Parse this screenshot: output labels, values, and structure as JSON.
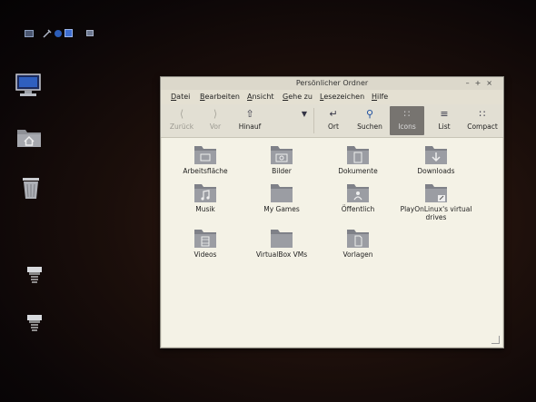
{
  "taskbar": {
    "item_label": ""
  },
  "window": {
    "title": "Persönlicher Ordner",
    "controls": {
      "minimize": "–",
      "maximize": "+",
      "close": "×"
    }
  },
  "menu": [
    {
      "label": "Datei",
      "ul": "D",
      "rest": "atei"
    },
    {
      "label": "Bearbeiten",
      "ul": "B",
      "rest": "earbeiten"
    },
    {
      "label": "Ansicht",
      "ul": "A",
      "rest": "nsicht"
    },
    {
      "label": "Gehe zu",
      "ul": "G",
      "rest": "ehe zu"
    },
    {
      "label": "Lesezeichen",
      "ul": "L",
      "rest": "esezeichen"
    },
    {
      "label": "Hilfe",
      "ul": "H",
      "rest": "ilfe"
    }
  ],
  "toolbar": {
    "back": {
      "label": "Zurück",
      "icon": "arrow-left-icon",
      "enabled": false
    },
    "forward": {
      "label": "Vor",
      "icon": "arrow-right-icon",
      "enabled": false
    },
    "up": {
      "label": "Hinauf",
      "icon": "arrow-up-icon"
    },
    "location": {
      "label": "Ort",
      "icon": "location-icon"
    },
    "search": {
      "label": "Suchen",
      "icon": "magnifier-icon"
    },
    "view_icons": {
      "label": "Icons",
      "icon": "grid-icon",
      "active": true
    },
    "view_list": {
      "label": "List",
      "icon": "list-icon"
    },
    "view_compact": {
      "label": "Compact",
      "icon": "compact-icon"
    }
  },
  "files": [
    {
      "name": "Arbeitsfläche",
      "emblem": "desktop"
    },
    {
      "name": "Bilder",
      "emblem": "camera"
    },
    {
      "name": "Dokumente",
      "emblem": "document"
    },
    {
      "name": "Downloads",
      "emblem": "download"
    },
    {
      "name": "Musik",
      "emblem": "music"
    },
    {
      "name": "My Games",
      "emblem": ""
    },
    {
      "name": "Öffentlich",
      "emblem": "share"
    },
    {
      "name": "PlayOnLinux's virtual drives",
      "emblem": "link"
    },
    {
      "name": "Videos",
      "emblem": "film"
    },
    {
      "name": "VirtualBox VMs",
      "emblem": ""
    },
    {
      "name": "Vorlagen",
      "emblem": "template"
    }
  ],
  "colors": {
    "folder": "#9b9da3",
    "folder_dark": "#7f8188",
    "accent_active": "#777470"
  }
}
